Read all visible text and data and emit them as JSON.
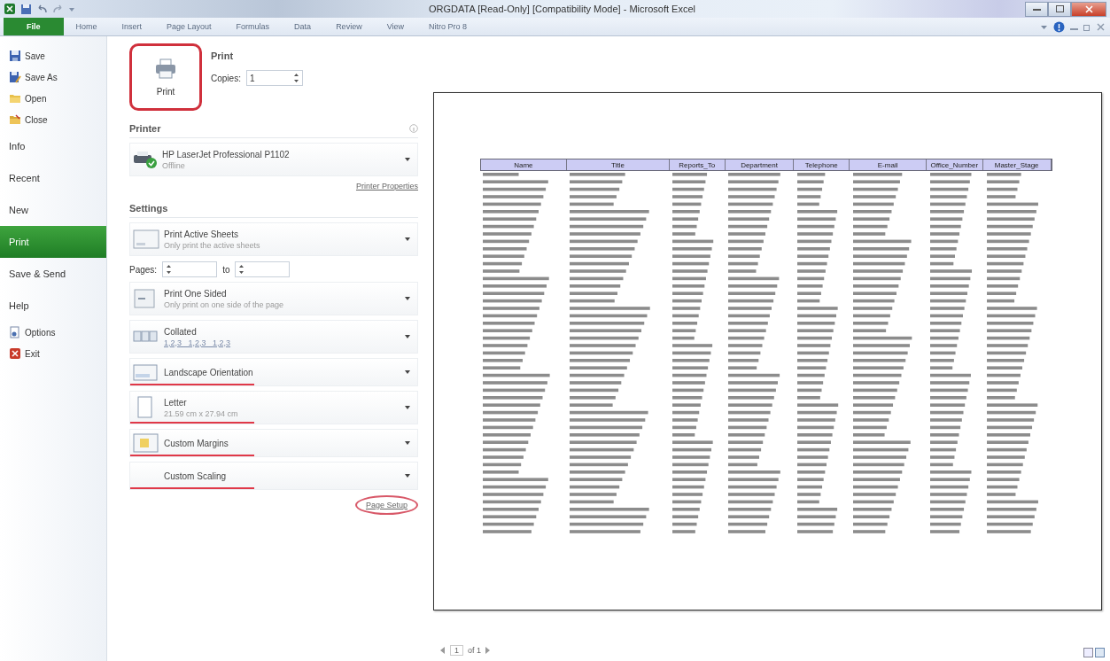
{
  "window": {
    "title": "ORGDATA  [Read-Only]  [Compatibility Mode]  -  Microsoft Excel"
  },
  "ribbon_tabs": [
    {
      "label": "File",
      "selected": true
    },
    {
      "label": "Home",
      "selected": false
    },
    {
      "label": "Insert",
      "selected": false
    },
    {
      "label": "Page Layout",
      "selected": false
    },
    {
      "label": "Formulas",
      "selected": false
    },
    {
      "label": "Data",
      "selected": false
    },
    {
      "label": "Review",
      "selected": false
    },
    {
      "label": "View",
      "selected": false
    },
    {
      "label": "Nitro Pro 8",
      "selected": false
    }
  ],
  "backstage_nav": [
    {
      "label": "Save",
      "kind": "save",
      "selected": false
    },
    {
      "label": "Save As",
      "kind": "saveas",
      "selected": false
    },
    {
      "label": "Open",
      "kind": "open",
      "selected": false
    },
    {
      "label": "Close",
      "kind": "close",
      "selected": false
    },
    {
      "label": "Info",
      "kind": "page",
      "selected": false
    },
    {
      "label": "Recent",
      "kind": "page",
      "selected": false
    },
    {
      "label": "New",
      "kind": "page",
      "selected": false
    },
    {
      "label": "Print",
      "kind": "page",
      "selected": true
    },
    {
      "label": "Save & Send",
      "kind": "page",
      "selected": false
    },
    {
      "label": "Help",
      "kind": "page",
      "selected": false
    },
    {
      "label": "Options",
      "kind": "options",
      "selected": false
    },
    {
      "label": "Exit",
      "kind": "exit",
      "selected": false
    }
  ],
  "print": {
    "heading": "Print",
    "button": "Print",
    "highlighted": true,
    "copies_label": "Copies:",
    "copies_value": "1"
  },
  "printer": {
    "heading": "Printer",
    "name": "HP LaserJet Professional P1102",
    "status": "Offline",
    "properties_link": "Printer Properties"
  },
  "settings": {
    "heading": "Settings",
    "items": [
      {
        "kind": "sheets",
        "title": "Print Active Sheets",
        "subtitle": "Only print the active sheets",
        "underlined": false
      },
      {
        "kind": "range",
        "label": "Pages:",
        "to": "to"
      },
      {
        "kind": "sides",
        "title": "Print One Sided",
        "subtitle": "Only print on one side of the page",
        "underlined": false
      },
      {
        "kind": "collation",
        "title": "Collated",
        "subtitle": "1,2,3   1,2,3   1,2,3",
        "underlined": false
      },
      {
        "kind": "orientation",
        "title": "Landscape Orientation",
        "underlined": true
      },
      {
        "kind": "paper",
        "title": "Letter",
        "subtitle": "21.59 cm x 27.94 cm",
        "underlined": true
      },
      {
        "kind": "margins",
        "title": "Custom Margins",
        "underlined": true
      },
      {
        "kind": "scaling",
        "title": "Custom Scaling",
        "underlined": true
      }
    ],
    "page_setup_link": "Page Setup",
    "page_setup_circled": true
  },
  "preview": {
    "columns": [
      "Name",
      "Title",
      "Reports_To",
      "Department",
      "Telephone",
      "E-mail",
      "Office_Number",
      "Master_Stage"
    ],
    "page_number": "1",
    "page_count": "of 1"
  }
}
